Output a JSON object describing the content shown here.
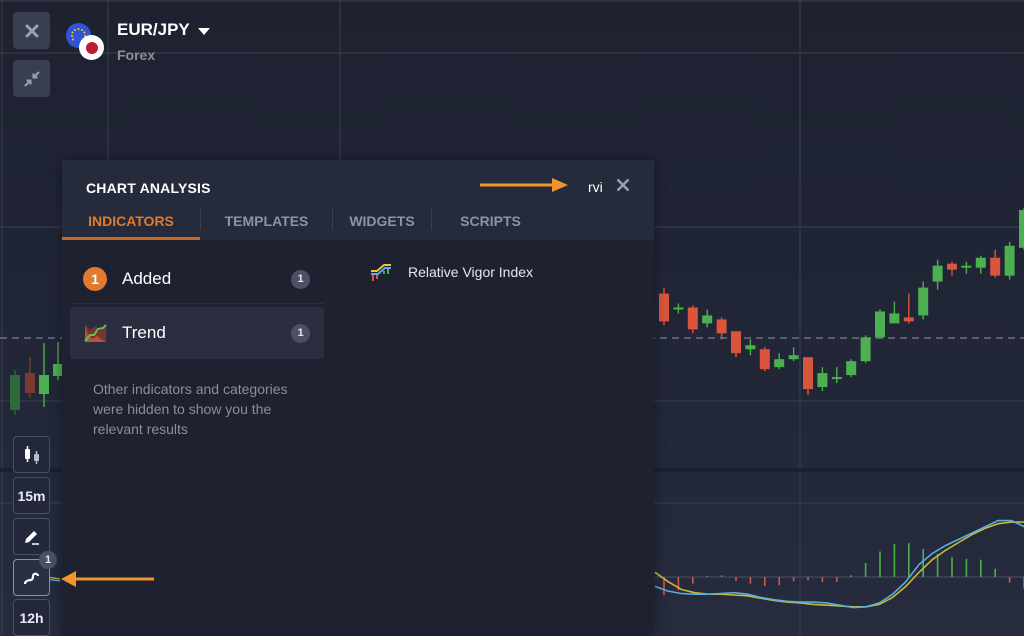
{
  "asset": {
    "pair": "EUR/JPY",
    "category": "Forex"
  },
  "toolbar": {
    "close_icon": "close-icon",
    "collapse_icon": "collapse-arrows-icon",
    "chart_type_icon": "candlestick-icon",
    "timeframe_label": "15m",
    "draw_icon": "pencil-icon",
    "indicators_icon": "wave-icon",
    "indicators_badge": "1",
    "period_label": "12h"
  },
  "panel": {
    "title": "CHART ANALYSIS",
    "search_value": "rvi",
    "close_icon": "close-icon",
    "tabs": [
      {
        "label": "INDICATORS",
        "active": true
      },
      {
        "label": "TEMPLATES",
        "active": false
      },
      {
        "label": "WIDGETS",
        "active": false
      },
      {
        "label": "SCRIPTS",
        "active": false
      }
    ],
    "categories": [
      {
        "label": "Added",
        "icon_number": "1",
        "count": "1",
        "selected": false
      },
      {
        "label": "Trend",
        "icon": "trend-icon",
        "count": "1",
        "selected": true
      }
    ],
    "hint": "Other indicators and categories were hidden to show you the relevant results",
    "results": [
      {
        "label": "Relative Vigor Index",
        "icon": "rvi-indicator-icon"
      }
    ]
  },
  "colors": {
    "accent": "#e07a2e",
    "bull": "#4caf50",
    "bear": "#d9553b",
    "rvi_line": "#5aaee0",
    "signal_line": "#c9b73a",
    "annotation_arrow": "#f0952b"
  },
  "chart_data": {
    "type": "candlestick",
    "note": "Price values in relative units (no price axis visible)",
    "candles": [
      {
        "o": 58,
        "c": 44,
        "h": 61,
        "l": 42
      },
      {
        "o": 50,
        "c": 51,
        "h": 53,
        "l": 48
      },
      {
        "o": 51,
        "c": 40,
        "h": 52,
        "l": 38
      },
      {
        "o": 43,
        "c": 47,
        "h": 50,
        "l": 41
      },
      {
        "o": 45,
        "c": 38,
        "h": 46,
        "l": 35
      },
      {
        "o": 39,
        "c": 28,
        "h": 39,
        "l": 26
      },
      {
        "o": 30,
        "c": 32,
        "h": 35,
        "l": 27
      },
      {
        "o": 30,
        "c": 20,
        "h": 31,
        "l": 19
      },
      {
        "o": 21,
        "c": 25,
        "h": 28,
        "l": 20
      },
      {
        "o": 25,
        "c": 27,
        "h": 31,
        "l": 24
      },
      {
        "o": 26,
        "c": 10,
        "h": 26,
        "l": 7
      },
      {
        "o": 11,
        "c": 18,
        "h": 21,
        "l": 9
      },
      {
        "o": 15,
        "c": 16,
        "h": 21,
        "l": 13
      },
      {
        "o": 17,
        "c": 24,
        "h": 25,
        "l": 16
      },
      {
        "o": 24,
        "c": 36,
        "h": 37,
        "l": 23
      },
      {
        "o": 36,
        "c": 49,
        "h": 50,
        "l": 36
      },
      {
        "o": 43,
        "c": 48,
        "h": 54,
        "l": 43
      },
      {
        "o": 46,
        "c": 44,
        "h": 58,
        "l": 43
      },
      {
        "o": 47,
        "c": 61,
        "h": 64,
        "l": 45
      },
      {
        "o": 64,
        "c": 72,
        "h": 75,
        "l": 60
      },
      {
        "o": 73,
        "c": 70,
        "h": 74,
        "l": 67
      },
      {
        "o": 71,
        "c": 72,
        "h": 74,
        "l": 68
      },
      {
        "o": 71,
        "c": 76,
        "h": 77,
        "l": 68
      },
      {
        "o": 76,
        "c": 67,
        "h": 80,
        "l": 66
      },
      {
        "o": 67,
        "c": 82,
        "h": 84,
        "l": 65
      },
      {
        "o": 81,
        "c": 100,
        "h": 101,
        "l": 80
      }
    ],
    "rvi": {
      "rvi_line": [
        -0.6,
        -0.9,
        -1.05,
        -1.1,
        -1.1,
        -1.05,
        -1.0,
        -1.1,
        -1.3,
        -1.45,
        -1.55,
        -1.6,
        -1.6,
        -1.65,
        -1.8,
        -1.95,
        -1.9,
        -1.65,
        -1.1,
        -0.3,
        0.8,
        1.5,
        2.0,
        2.4,
        2.8,
        3.2,
        3.6,
        3.6,
        3.2
      ],
      "signal_line": [
        0.3,
        -0.3,
        -0.8,
        -1.0,
        -1.1,
        -1.1,
        -1.15,
        -1.2,
        -1.35,
        -1.5,
        -1.6,
        -1.65,
        -1.75,
        -1.8,
        -1.85,
        -1.9,
        -1.9,
        -1.75,
        -1.3,
        -0.6,
        0.3,
        1.1,
        1.7,
        2.2,
        2.7,
        3.1,
        3.4,
        3.5,
        3.5
      ],
      "histogram": [
        -1.1,
        -0.8,
        -0.4,
        0.05,
        0.1,
        -0.25,
        -0.4,
        -0.55,
        -0.5,
        -0.25,
        -0.2,
        -0.3,
        -0.3,
        0.1,
        0.85,
        1.55,
        2.0,
        2.05,
        1.7,
        1.4,
        1.2,
        1.1,
        1.05,
        0.5,
        -0.35,
        -0.7
      ]
    }
  }
}
